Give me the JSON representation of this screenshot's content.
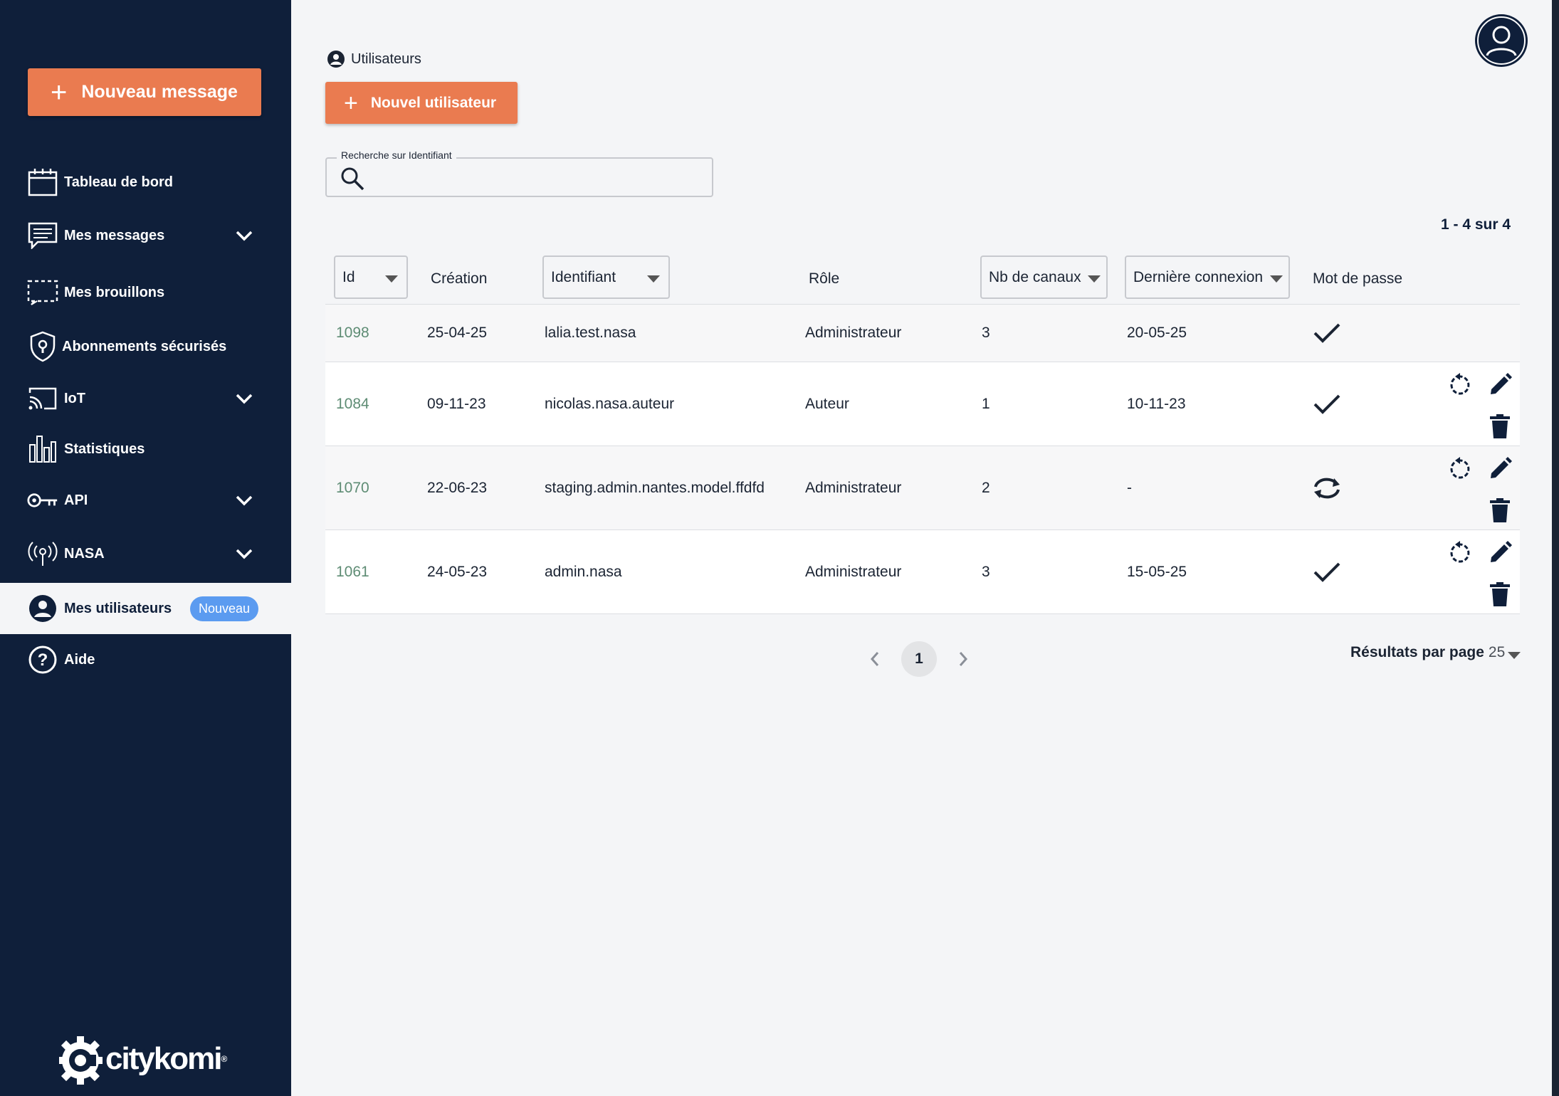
{
  "sidebar": {
    "new_message_label": "Nouveau message",
    "items": [
      {
        "label": "Tableau de bord"
      },
      {
        "label": "Mes messages"
      },
      {
        "label": "Mes brouillons"
      },
      {
        "label": "Abonnements sécurisés"
      },
      {
        "label": "IoT"
      },
      {
        "label": "Statistiques"
      },
      {
        "label": "API"
      },
      {
        "label": "NASA"
      },
      {
        "label": "Mes utilisateurs",
        "badge": "Nouveau"
      },
      {
        "label": "Aide"
      }
    ],
    "logo_text": "citykomi",
    "logo_mark": "®"
  },
  "header": {
    "breadcrumb": "Utilisateurs",
    "new_user_label": "Nouvel utilisateur"
  },
  "search": {
    "legend": "Recherche sur Identifiant",
    "value": ""
  },
  "results": {
    "count_text": "1 - 4 sur 4",
    "per_page_label": "Résultats par page",
    "per_page_value": "25",
    "current_page": "1"
  },
  "table": {
    "headers": {
      "id": "Id",
      "creation": "Création",
      "identifiant": "Identifiant",
      "role": "Rôle",
      "canaux": "Nb de canaux",
      "connexion": "Dernière connexion",
      "password": "Mot de passe"
    },
    "rows": [
      {
        "id": "1098",
        "creation": "25-04-25",
        "identifiant": "lalia.test.nasa",
        "role": "Administrateur",
        "canaux": "3",
        "connexion": "20-05-25",
        "password_status": "check-icon"
      },
      {
        "id": "1084",
        "creation": "09-11-23",
        "identifiant": "nicolas.nasa.auteur",
        "role": "Auteur",
        "canaux": "1",
        "connexion": "10-11-23",
        "password_status": "check-icon"
      },
      {
        "id": "1070",
        "creation": "22-06-23",
        "identifiant": "staging.admin.nantes.model.ffdfd",
        "role": "Administrateur",
        "canaux": "2",
        "connexion": "-",
        "password_status": "sync-icon"
      },
      {
        "id": "1061",
        "creation": "24-05-23",
        "identifiant": "admin.nasa",
        "role": "Administrateur",
        "canaux": "3",
        "connexion": "15-05-25",
        "password_status": "check-icon"
      }
    ]
  },
  "colors": {
    "sidebar_bg": "#0f1f3a",
    "accent": "#ea7b50",
    "badge": "#5b9bf0",
    "id_link": "#5e8c74"
  }
}
